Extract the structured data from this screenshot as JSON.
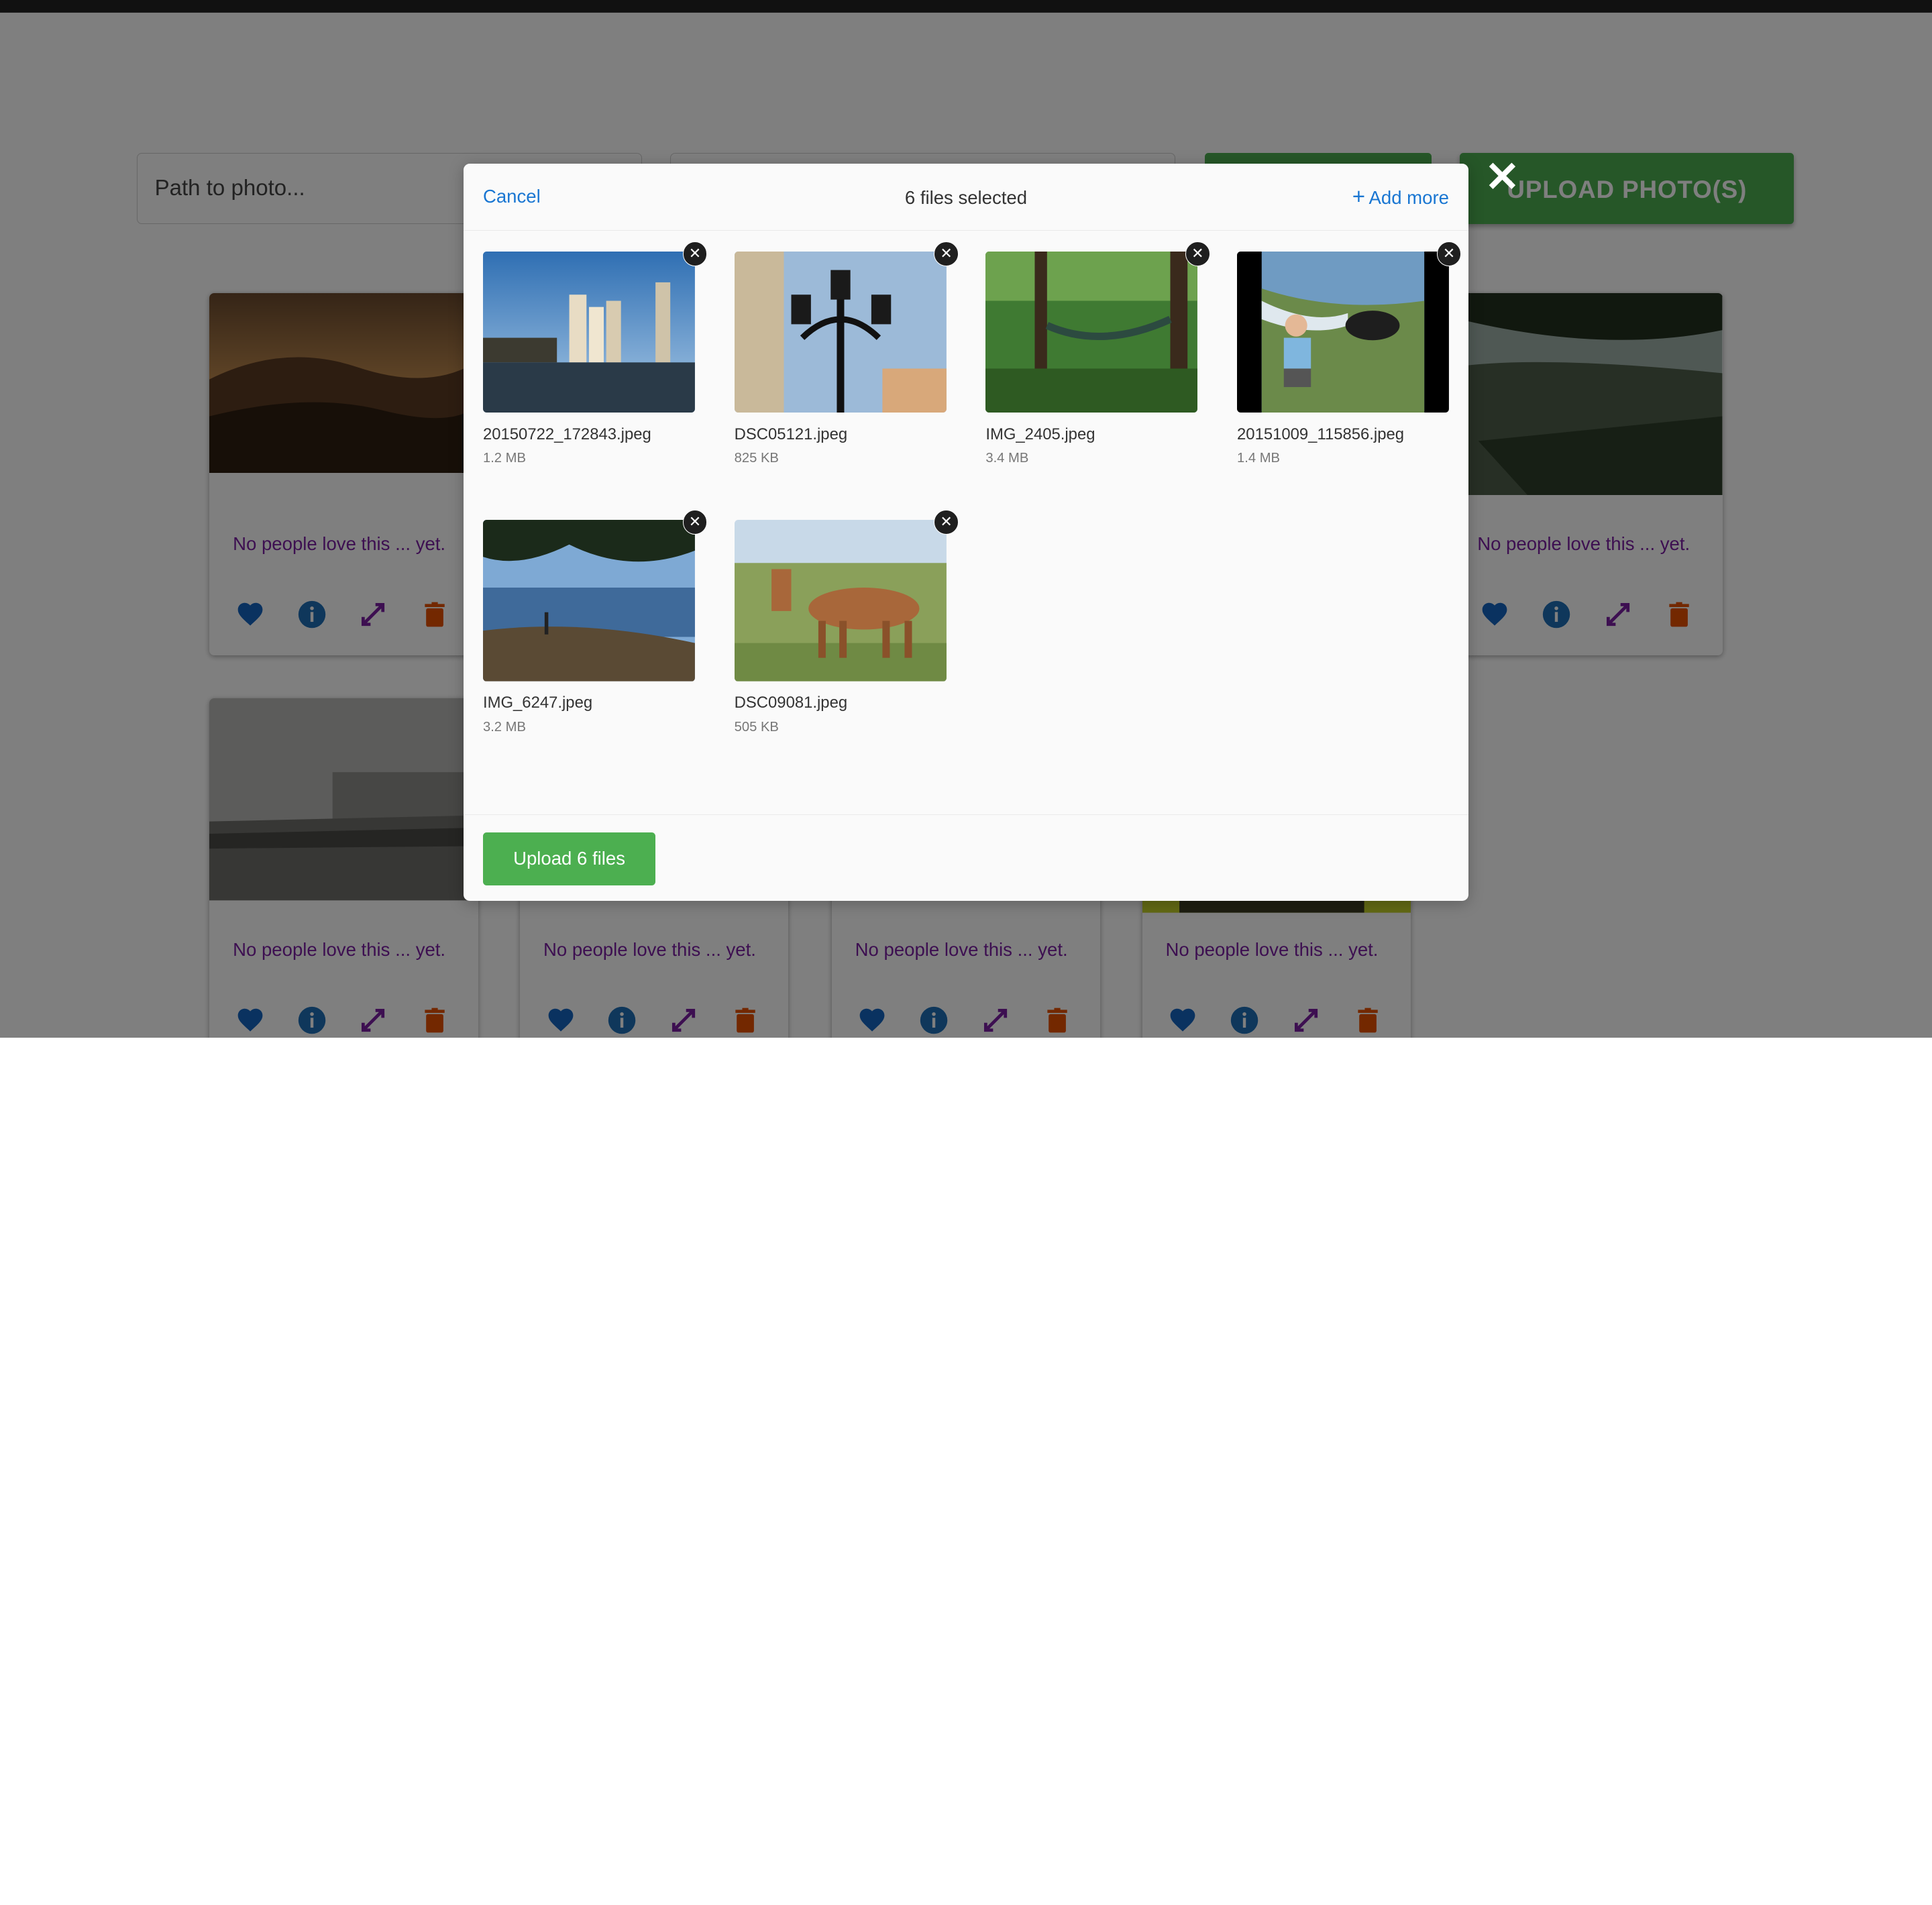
{
  "path_input": {
    "placeholder": "Path to photo..."
  },
  "upload_button_label": "UPLOAD PHOTO(S)",
  "cards": [
    {
      "caption": "No people love this ... yet."
    },
    {
      "caption": "No people love this ... yet."
    },
    {
      "caption": "No people love this ... yet."
    },
    {
      "caption": "No people love this ... yet."
    },
    {
      "caption": "No people love this ... yet."
    },
    {
      "caption": "No people love this ... yet."
    }
  ],
  "card_icons": [
    "heart-icon",
    "info-icon",
    "expand-icon",
    "trash-icon"
  ],
  "colors": {
    "love_text": "#7b1fa2",
    "heart": "#1565c0",
    "info": "#1e6fb7",
    "expand": "#7b1fa2",
    "trash": "#e65100",
    "upload_green": "#4caf50"
  },
  "modal": {
    "cancel_label": "Cancel",
    "title": "6 files selected",
    "add_more_label": "Add more",
    "add_more_icon": "plus-icon",
    "files": [
      {
        "name": "20150722_172843.jpeg",
        "size": "1.2 MB"
      },
      {
        "name": "DSC05121.jpeg",
        "size": "825 KB"
      },
      {
        "name": "IMG_2405.jpeg",
        "size": "3.4 MB"
      },
      {
        "name": "20151009_115856.jpeg",
        "size": "1.4 MB"
      },
      {
        "name": "IMG_6247.jpeg",
        "size": "3.2 MB"
      },
      {
        "name": "DSC09081.jpeg",
        "size": "505 KB"
      }
    ],
    "upload_label": "Upload 6 files"
  }
}
